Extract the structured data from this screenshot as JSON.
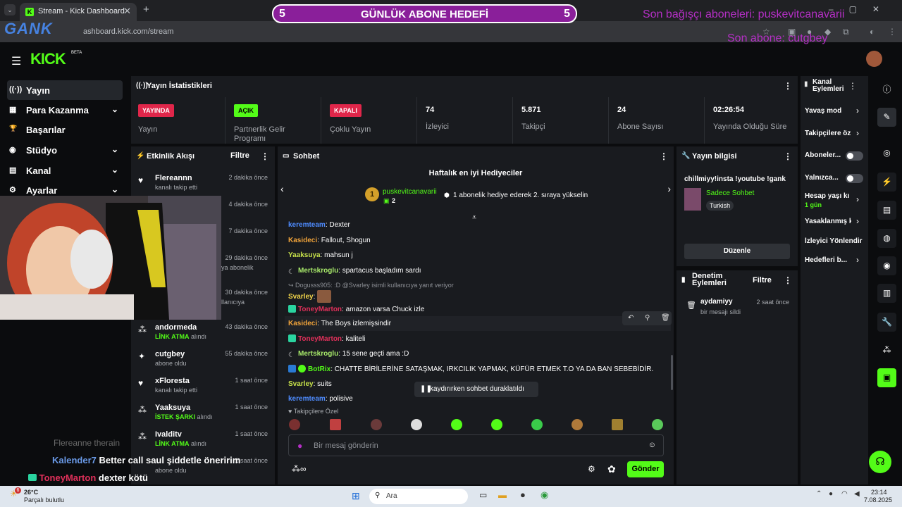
{
  "browser": {
    "tab_title": "Stream - Kick Dashboard",
    "url": "ashboard.kick.com/stream"
  },
  "overlay": {
    "goal_left": "5",
    "goal_title": "GÜNLÜK ABONE HEDEFİ",
    "goal_right": "5",
    "last_donor_subs": "Son bağışçı aboneleri: puskevitcanavarii",
    "last_sub": "Son abone: cutgbey",
    "logo_text": "GANK"
  },
  "header": {
    "logo": "KICK",
    "beta": "BETA"
  },
  "nav": {
    "items": [
      {
        "label": "Yayın",
        "icon": "((·))"
      },
      {
        "label": "Para Kazanma",
        "icon": "▦"
      },
      {
        "label": "Başarılar",
        "icon": "🏆"
      },
      {
        "label": "Stüdyo",
        "icon": "◉"
      },
      {
        "label": "Kanal",
        "icon": "▤"
      },
      {
        "label": "Ayarlar",
        "icon": "⚙"
      }
    ]
  },
  "stats": {
    "title": "Yayın İstatistikleri",
    "items": [
      {
        "badge": "YAYINDA",
        "label": "Yayın"
      },
      {
        "badge": "AÇIK",
        "label": "Partnerlik Gelir Programı"
      },
      {
        "badge": "KAPALI",
        "label": "Çoklu Yayın"
      },
      {
        "value": "74",
        "label": "İzleyici"
      },
      {
        "value": "5.871",
        "label": "Takipçi"
      },
      {
        "value": "24",
        "label": "Abone Sayısı"
      },
      {
        "value": "02:26:54",
        "label": "Yayında Olduğu Süre"
      }
    ]
  },
  "activity": {
    "title": "Etkinlik Akışı",
    "filter": "Filtre",
    "items": [
      {
        "name": "Flereannn",
        "sub": "kanalı takip etti",
        "time": "2 dakika önce"
      },
      {
        "name": "",
        "sub": "",
        "time": "4 dakika önce"
      },
      {
        "name": "",
        "sub": "",
        "time": "7 dakika önce"
      },
      {
        "name": "",
        "sub": "ya abonelik",
        "time": "29 dakika önce"
      },
      {
        "name": "",
        "sub": "llanıcıya",
        "time": "30 dakika önce"
      },
      {
        "name": "andormeda",
        "sub_hl": "LİNK ATMA",
        "sub": " alındı",
        "time": "43 dakika önce"
      },
      {
        "name": "cutgbey",
        "sub": "abone oldu",
        "time": "55 dakika önce"
      },
      {
        "name": "xFloresta",
        "sub": "kanalı takip etti",
        "time": "1 saat önce"
      },
      {
        "name": "Yaaksuya",
        "sub_hl": "İSTEK ŞARKI",
        "sub": " alındı",
        "time": "1 saat önce"
      },
      {
        "name": "Ivalditv",
        "sub_hl": "LİNK ATMA",
        "sub": " alındı",
        "time": "1 saat önce"
      },
      {
        "name": "",
        "sub": "abone oldu",
        "time": "1 saat önce"
      }
    ]
  },
  "chat": {
    "title": "Sohbet",
    "top_gifters_title": "Haftalık en iyi Hediyeciler",
    "top_gifter_rank": "1",
    "top_gifter_name": "puskevitcanavarii",
    "top_gifter_count": "2",
    "promo": "1 abonelik hediye ederek 2. sıraya yükselin",
    "reply_preview": "Dogusss905: :D @Svarley isimli kullanıcıya yanıt veriyor",
    "messages": [
      {
        "user": "keremteam",
        "color": "#4e8cff",
        "text": ": Dexter"
      },
      {
        "user": "Kasideci",
        "color": "#f0a33a",
        "text": ": Fallout, Shogun"
      },
      {
        "user": "Yaaksuya",
        "color": "#c6e04a",
        "text": ": mahsun j"
      },
      {
        "user": "Mertskroglu",
        "color": "#a7e86a",
        "text": ": spartacus başladım sardı"
      },
      {
        "user": "Svarley",
        "color": "#f0d44a",
        "text": ":"
      },
      {
        "user": "ToneyMarton",
        "color": "#e0305a",
        "text": ": amazon varsa Chuck izle"
      },
      {
        "user": "Kasideci",
        "color": "#f0a33a",
        "text": ": The Boys izlemişsindir"
      },
      {
        "user": "ToneyMarton",
        "color": "#e0305a",
        "text": ": kaliteli"
      },
      {
        "user": "Mertskroglu",
        "color": "#a7e86a",
        "text": ": 15 sene geçti ama :D"
      },
      {
        "user": "BotRix",
        "color": "#53fc18",
        "text": ": CHATTE BİRİLERİNE SATAŞMAK, IRKCILIK YAPMAK, KÜFÜR ETMEK T.O YA DA BAN SEBEBİDİR."
      },
      {
        "user": "Svarley",
        "color": "#c6e04a",
        "text": ": suits"
      },
      {
        "user": "keremteam",
        "color": "#4e8cff",
        "text": ": polisive"
      }
    ],
    "paused": "kaydırırken sohbet duraklatıldı",
    "followers_only": "Takipçilere Özel",
    "input_placeholder": "Bir mesaj gönderin",
    "send": "Gönder"
  },
  "stream_info": {
    "title": "Yayın bilgisi",
    "stream_title": "chillmiyy!insta !youtube !gank",
    "category": "Sadece Sohbet",
    "tag": "Turkish",
    "edit": "Düzenle"
  },
  "moderation": {
    "title": "Denetim Eylemleri",
    "filter": "Filtre",
    "item_user": "aydamiyy",
    "item_action": "bir mesajı sildi",
    "item_time": "2 saat önce"
  },
  "channel_actions": {
    "title": "Kanal Eylemleri",
    "items": [
      {
        "label": "Yavaş mod",
        "type": "chevron"
      },
      {
        "label": "Takipçilere öz",
        "type": "chevron"
      },
      {
        "label": "Aboneler...",
        "type": "toggle"
      },
      {
        "label": "Yalnızca...",
        "type": "toggle"
      },
      {
        "label": "Hesap yaşı kı",
        "sub": "1 gün",
        "type": "chevron"
      },
      {
        "label": "Yasaklanmış k",
        "type": "chevron"
      },
      {
        "label": "İzleyici Yönlendir",
        "type": "none"
      },
      {
        "label": "Hedefleri b...",
        "type": "chevron"
      }
    ]
  },
  "webcam_chat": {
    "faded": "Flereanne therain",
    "line1_user": "Kalender7",
    "line1_text": "Better call saul şiddetle öneririm",
    "line2_user": "ToneyMarton",
    "line2_text": "dexter kötü"
  },
  "taskbar": {
    "temp": "26°C",
    "weather": "Parçalı bulutlu",
    "search": "Ara",
    "time": "23:14",
    "date": "7.08.2025",
    "badge": "6"
  },
  "colors": {
    "accent": "#53fc18",
    "panel": "#191b1f",
    "overlay_purple": "#b52fc6"
  }
}
